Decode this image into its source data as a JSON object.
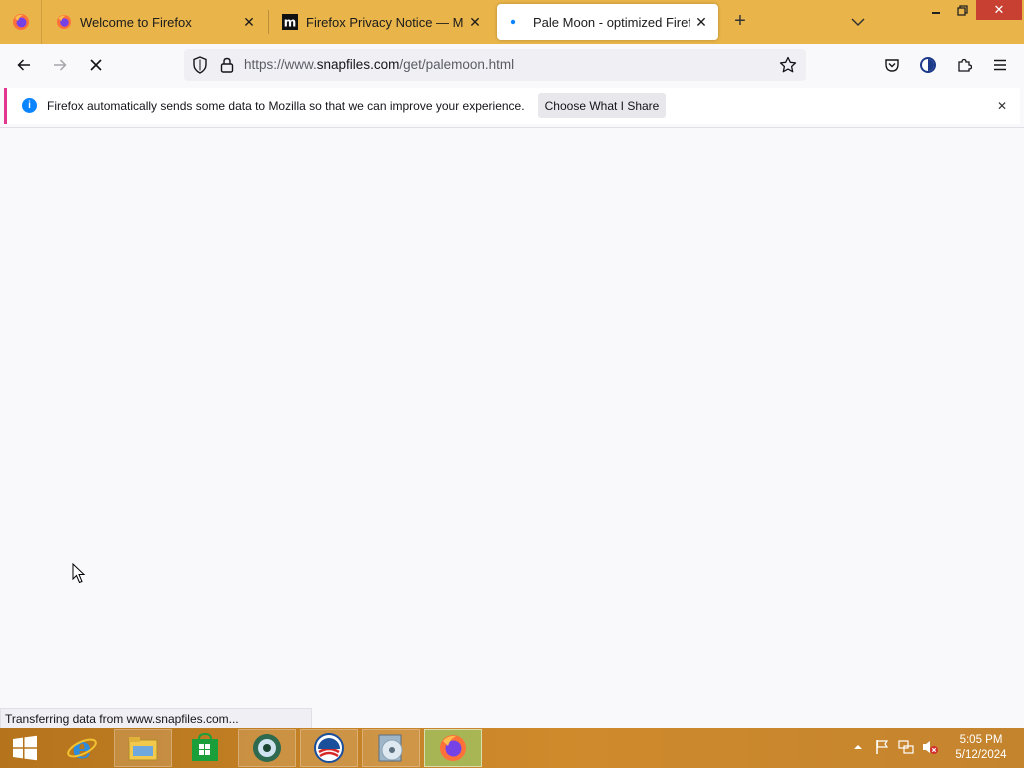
{
  "tabs": [
    {
      "title": "Welcome to Firefox",
      "favicon": "firefox-icon",
      "active": false
    },
    {
      "title": "Firefox Privacy Notice — Mozilla",
      "favicon": "mozilla-m-icon",
      "active": false
    },
    {
      "title": "Pale Moon - optimized Firefox b",
      "favicon": "loading-dot-icon",
      "active": true
    }
  ],
  "navbar": {
    "url_prefix": "https://www.",
    "url_host": "snapfiles.com",
    "url_path": "/get/palemoon.html"
  },
  "notification": {
    "message": "Firefox automatically sends some data to Mozilla so that we can improve your experience.",
    "button_label": "Choose What I Share",
    "info_glyph": "i"
  },
  "status": {
    "text": "Transferring data from www.snapfiles.com..."
  },
  "taskbar": {
    "items": [
      "internet-explorer-icon",
      "file-explorer-icon",
      "store-icon",
      "media-player-icon",
      "obama-app-icon",
      "cd-burner-icon",
      "firefox-icon"
    ],
    "time": "5:05 PM",
    "date": "5/12/2024"
  },
  "colors": {
    "tabstrip": "#e9b54a",
    "notification_accent": "#e2368f",
    "info_blue": "#0a84ff",
    "close_red": "#c84031"
  }
}
